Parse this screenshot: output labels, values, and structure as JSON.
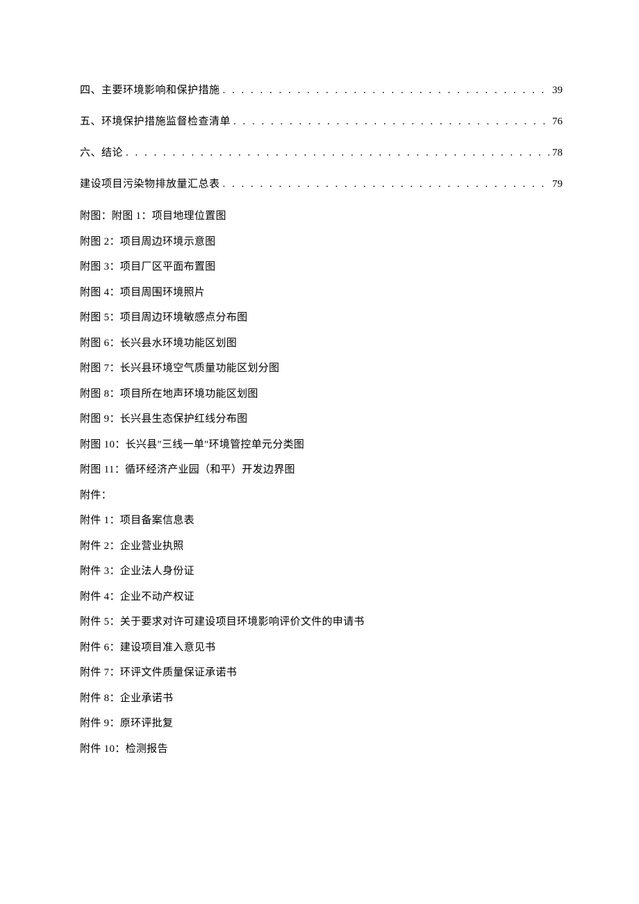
{
  "toc": [
    {
      "title": "四、主要环境影响和保护措施",
      "page": "39"
    },
    {
      "title": "五、环境保护措施监督检查清单",
      "page": "76"
    },
    {
      "title": "六、结论",
      "page": "78"
    },
    {
      "title": "建设项目污染物排放量汇总表",
      "page": "79"
    }
  ],
  "figures_heading": "附图：附图 1：项目地理位置图",
  "figures": [
    {
      "prefix": "附图 ",
      "num": "2",
      "label": "：项目周边环境示意图"
    },
    {
      "prefix": "附图 ",
      "num": "3",
      "label": "：项目厂区平面布置图"
    },
    {
      "prefix": "附图 ",
      "num": "4",
      "label": "：项目周围环境照片"
    },
    {
      "prefix": "附图 ",
      "num": "5",
      "label": "：项目周边环境敏感点分布图"
    },
    {
      "prefix": "附图 ",
      "num": "6",
      "label": "：长兴县水环境功能区划图"
    },
    {
      "prefix": "附图 ",
      "num": "7",
      "label": "：长兴县环境空气质量功能区划分图"
    },
    {
      "prefix": "附图 ",
      "num": "8",
      "label": "：项目所在地声环境功能区划图"
    },
    {
      "prefix": "附图 ",
      "num": "9",
      "label": "：长兴县生态保护红线分布图"
    },
    {
      "prefix": "附图 ",
      "num": "10",
      "label": "：长兴县\"三线一单\"环境管控单元分类图"
    },
    {
      "prefix": "附图 ",
      "num": "11",
      "label": "：循环经济产业园（和平）开发边界图"
    }
  ],
  "attachments_heading": "附件：",
  "attachments": [
    {
      "prefix": "附件 ",
      "num": "1",
      "label": "：项目备案信息表"
    },
    {
      "prefix": "附件 ",
      "num": "2",
      "label": "：企业营业执照"
    },
    {
      "prefix": "附件 ",
      "num": "3",
      "label": "：企业法人身份证"
    },
    {
      "prefix": "附件 ",
      "num": "4",
      "label": "：企业不动产权证"
    },
    {
      "prefix": "附件 ",
      "num": "5",
      "label": "：关于要求对许可建设项目环境影响评价文件的申请书"
    },
    {
      "prefix": "附件 ",
      "num": "6",
      "label": "：建设项目准入意见书"
    },
    {
      "prefix": "附件 ",
      "num": "7",
      "label": "：环评文件质量保证承诺书"
    },
    {
      "prefix": "附件 ",
      "num": "8",
      "label": "：企业承诺书"
    },
    {
      "prefix": "附件 ",
      "num": "9",
      "label": "：原环评批复"
    },
    {
      "prefix": "附件 ",
      "num": "10",
      "label": "：检测报告"
    }
  ],
  "dots": ". . . . . . . . . . . . . . . . . . . . . . . . . . . . . . . . . . . . . . . . . . . . . . . . . . . . . . . . . . . . . . . . . . . . . . . . . . . . . . . . . . . . . . . . . . . . . . . . . . . ."
}
